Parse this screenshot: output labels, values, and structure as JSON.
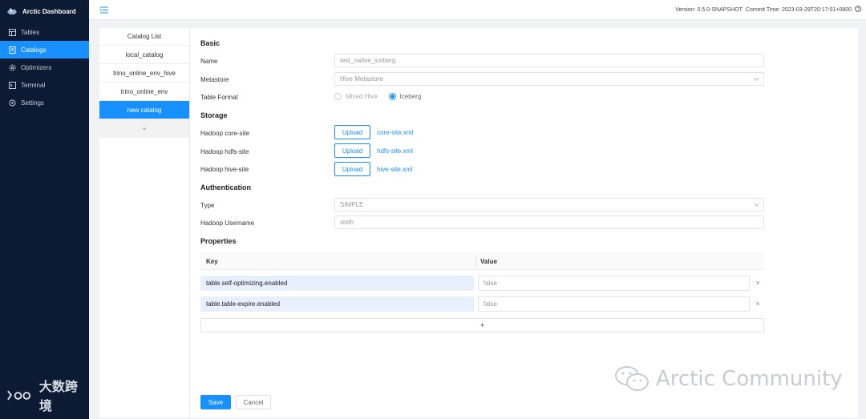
{
  "app": {
    "title": "Arctic Dashboard"
  },
  "sidebar": {
    "items": [
      {
        "label": "Tables",
        "icon": "table-icon"
      },
      {
        "label": "Catalogs",
        "icon": "catalog-icon",
        "active": true
      },
      {
        "label": "Optimizers",
        "icon": "gear-icon"
      },
      {
        "label": "Terminal",
        "icon": "terminal-icon"
      },
      {
        "label": "Settings",
        "icon": "settings-icon"
      }
    ]
  },
  "header": {
    "version": "Version: 0.5.0-SNAPSHOT",
    "commit_time": "Commit Time: 2023-03-29T20:17:01+0800"
  },
  "catalogs": {
    "title": "Catalog List",
    "items": [
      {
        "label": "local_catalog"
      },
      {
        "label": "trino_online_env_hive"
      },
      {
        "label": "trino_online_env"
      },
      {
        "label": "new catalog",
        "active": true
      }
    ],
    "add_label": "+"
  },
  "form": {
    "basic": {
      "title": "Basic",
      "name_label": "Name",
      "name_value": "test_native_iceberg",
      "metastore_label": "Metastore",
      "metastore_value": "Hive Metastore",
      "table_format_label": "Table Format",
      "format_options": [
        {
          "label": "Mixed Hive",
          "checked": false,
          "disabled": true
        },
        {
          "label": "Iceberg",
          "checked": true
        }
      ]
    },
    "storage": {
      "title": "Storage",
      "rows": [
        {
          "label": "Hadoop core-site",
          "button": "Upload",
          "file": "core-site.xml"
        },
        {
          "label": "Hadoop hdfs-site",
          "button": "Upload",
          "file": "hdfs-site.xml"
        },
        {
          "label": "Hadoop hive-site",
          "button": "Upload",
          "file": "hive-site.xml"
        }
      ]
    },
    "authentication": {
      "title": "Authentication",
      "type_label": "Type",
      "type_value": "SIMPLE",
      "username_label": "Hadoop Username",
      "username_value": "sloth"
    },
    "properties": {
      "title": "Properties",
      "key_header": "Key",
      "value_header": "Value",
      "rows": [
        {
          "key": "table.self-optimizing.enabled",
          "value": "false",
          "delete": "×"
        },
        {
          "key": "table.table-expire.enabled",
          "value": "false",
          "delete": "×"
        }
      ],
      "add_label": "+"
    },
    "actions": {
      "save": "Save",
      "cancel": "Cancel"
    }
  },
  "watermarks": {
    "left": "大数跨境",
    "right": "Arctic Community"
  },
  "colors": {
    "primary": "#1890ff",
    "sidebar_bg": "#0c1b33"
  }
}
